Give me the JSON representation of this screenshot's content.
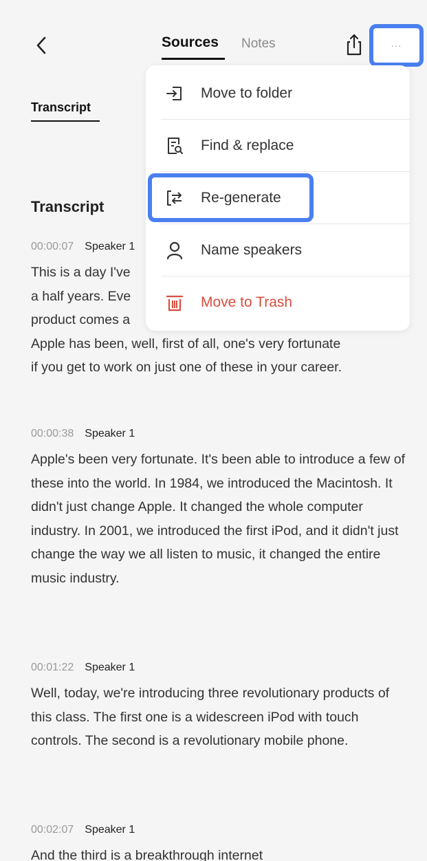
{
  "header": {
    "tabs": [
      {
        "label": "Sources",
        "active": true
      },
      {
        "label": "Notes",
        "active": false
      }
    ],
    "more_label": "···"
  },
  "subtab": {
    "label": "Transcript"
  },
  "section": {
    "title": "Transcript"
  },
  "entries": [
    {
      "timestamp": "00:00:07",
      "speaker": "Speaker 1",
      "text_lines": [
        "This is a day I've",
        "a half years. Eve",
        "product comes a",
        "Apple has been, well, first of all, one's very fortunate",
        "if you get to work on just one of these in your career."
      ]
    },
    {
      "timestamp": "00:00:38",
      "speaker": "Speaker 1",
      "text": "Apple's been very fortunate. It's been able to introduce a few of these into the world. In 1984, we introduced the Macintosh. It didn't just change Apple. It changed the whole computer industry. In 2001, we introduced the first iPod, and it didn't just change the way we all listen to music, it changed the entire music industry."
    },
    {
      "timestamp": "00:01:22",
      "speaker": "Speaker 1",
      "text": "Well, today, we're introducing three revolutionary products of this class. The first one is a widescreen iPod with touch controls. The second is a revolutionary mobile phone."
    },
    {
      "timestamp": "00:02:07",
      "speaker": "Speaker 1",
      "text": "And the third is a breakthrough internet"
    }
  ],
  "menu": {
    "items": [
      {
        "label": "Move to folder",
        "icon": "move-to-folder-icon"
      },
      {
        "label": "Find & replace",
        "icon": "find-replace-icon"
      },
      {
        "label": "Re-generate",
        "icon": "regenerate-icon",
        "highlighted": true
      },
      {
        "label": "Name speakers",
        "icon": "person-icon"
      },
      {
        "label": "Move to Trash",
        "icon": "trash-icon",
        "danger": true
      }
    ]
  },
  "colors": {
    "accent": "#4a7ff0",
    "danger": "#d94d3d",
    "background": "#f5f5f5"
  }
}
